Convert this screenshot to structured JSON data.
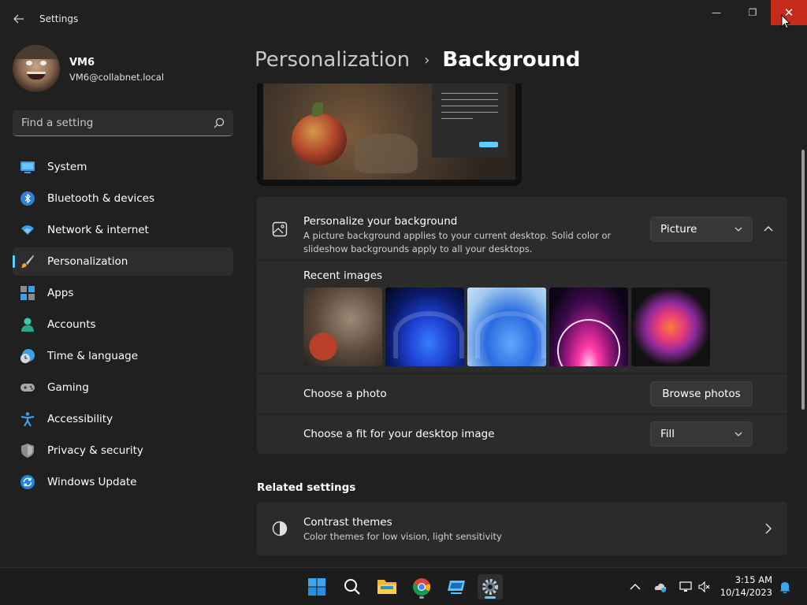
{
  "window": {
    "title": "Settings",
    "minimize_symbol": "—",
    "maximize_symbol": "❐",
    "close_symbol": "✕"
  },
  "user": {
    "name": "VM6",
    "email": "VM6@collabnet.local"
  },
  "search": {
    "placeholder": "Find a setting"
  },
  "nav": {
    "items": [
      {
        "label": "System",
        "icon": "system-icon"
      },
      {
        "label": "Bluetooth & devices",
        "icon": "bluetooth-icon"
      },
      {
        "label": "Network & internet",
        "icon": "wifi-icon"
      },
      {
        "label": "Personalization",
        "icon": "brush-icon",
        "active": true
      },
      {
        "label": "Apps",
        "icon": "apps-icon"
      },
      {
        "label": "Accounts",
        "icon": "person-icon"
      },
      {
        "label": "Time & language",
        "icon": "globe-clock-icon"
      },
      {
        "label": "Gaming",
        "icon": "gamepad-icon"
      },
      {
        "label": "Accessibility",
        "icon": "accessibility-icon"
      },
      {
        "label": "Privacy & security",
        "icon": "shield-icon"
      },
      {
        "label": "Windows Update",
        "icon": "update-icon"
      }
    ]
  },
  "breadcrumb": {
    "parent": "Personalization",
    "separator": "›",
    "current": "Background"
  },
  "background": {
    "title": "Personalize your background",
    "description": "A picture background applies to your current desktop. Solid color or slideshow backgrounds apply to all your desktops.",
    "type_value": "Picture",
    "recent_title": "Recent images",
    "choose_photo_label": "Choose a photo",
    "browse_label": "Browse photos",
    "fit_label": "Choose a fit for your desktop image",
    "fit_value": "Fill"
  },
  "related": {
    "title": "Related settings",
    "contrast_title": "Contrast themes",
    "contrast_desc": "Color themes for low vision, light sensitivity"
  },
  "taskbar": {
    "time": "3:15 AM",
    "date": "10/14/2023"
  },
  "colors": {
    "accent": "#60cdff",
    "close": "#c42b1c",
    "background": "#202020",
    "card": "#2b2b2b"
  }
}
